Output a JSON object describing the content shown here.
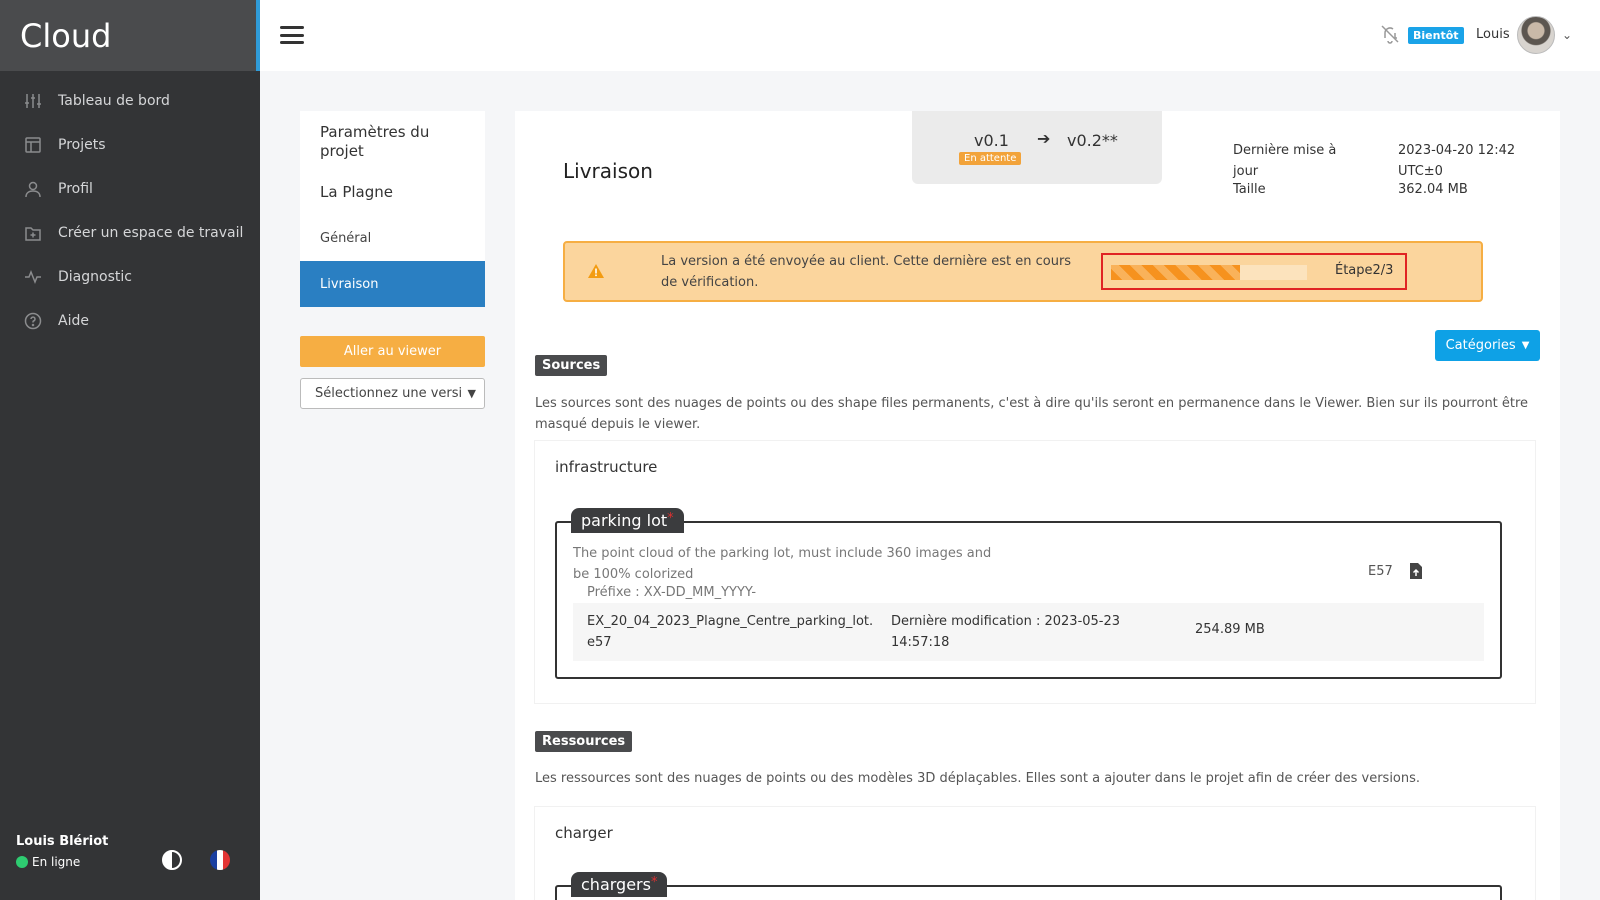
{
  "sidebar": {
    "brand": "Cloud",
    "items": [
      {
        "label": "Tableau de bord",
        "icon": "sliders-icon"
      },
      {
        "label": "Projets",
        "icon": "layout-icon"
      },
      {
        "label": "Profil",
        "icon": "user-icon"
      },
      {
        "label": "Créer un espace de travail",
        "icon": "folder-plus-icon"
      },
      {
        "label": "Diagnostic",
        "icon": "activity-icon"
      },
      {
        "label": "Aide",
        "icon": "help-circle-icon"
      }
    ],
    "footer": {
      "user_name": "Louis Blériot",
      "status": "En ligne",
      "status_color": "#2ecc71"
    }
  },
  "topbar": {
    "notifications_badge": "Bientôt",
    "user_name": "Louis"
  },
  "subnav": {
    "title": "Paramètres du projet",
    "project_name": "La Plagne",
    "items": [
      {
        "label": "Général",
        "active": false
      },
      {
        "label": "Livraison",
        "active": true
      }
    ],
    "viewer_button": "Aller au viewer",
    "version_select": "Sélectionnez une versi"
  },
  "main": {
    "title": "Livraison",
    "version": {
      "from": "v0.1",
      "to": "v0.2**",
      "status": "En attente"
    },
    "meta": {
      "last_update_label": "Dernière mise à jour",
      "last_update_value": "2023-04-20 12:42 UTC±0",
      "size_label": "Taille",
      "size_value": "362.04 MB"
    },
    "alert": {
      "text": "La version a été envoyée au client. Cette dernière est en cours de vérification.",
      "progress_fraction": 0.66,
      "step_label": "Étape2/3"
    },
    "categories_button": "Catégories",
    "sources": {
      "tag": "Sources",
      "description": "Les sources sont des nuages de points ou des shape files permanents, c'est à dire qu'ils seront en permanence dans le Viewer. Bien sur ils pourront être masqué depuis le viewer.",
      "group": {
        "title": "infrastructure",
        "item": {
          "name": "parking lot",
          "required_mark": "*",
          "description": "The point cloud of the parking lot, must include 360 images and be 100% colorized",
          "prefix": "Préfixe : XX-DD_MM_YYYY-",
          "format": "E57",
          "file": {
            "name": "EX_20_04_2023_Plagne_Centre_parking_lot.e57",
            "modified": "Dernière modification : 2023-05-23 14:57:18",
            "size": "254.89 MB"
          }
        }
      }
    },
    "resources": {
      "tag": "Ressources",
      "description": "Les ressources sont des nuages de points ou des modèles 3D déplaçables. Elles sont a ajouter dans le projet afin de créer des versions.",
      "group": {
        "title": "charger",
        "item": {
          "name": "chargers",
          "required_mark": "*"
        }
      }
    }
  }
}
